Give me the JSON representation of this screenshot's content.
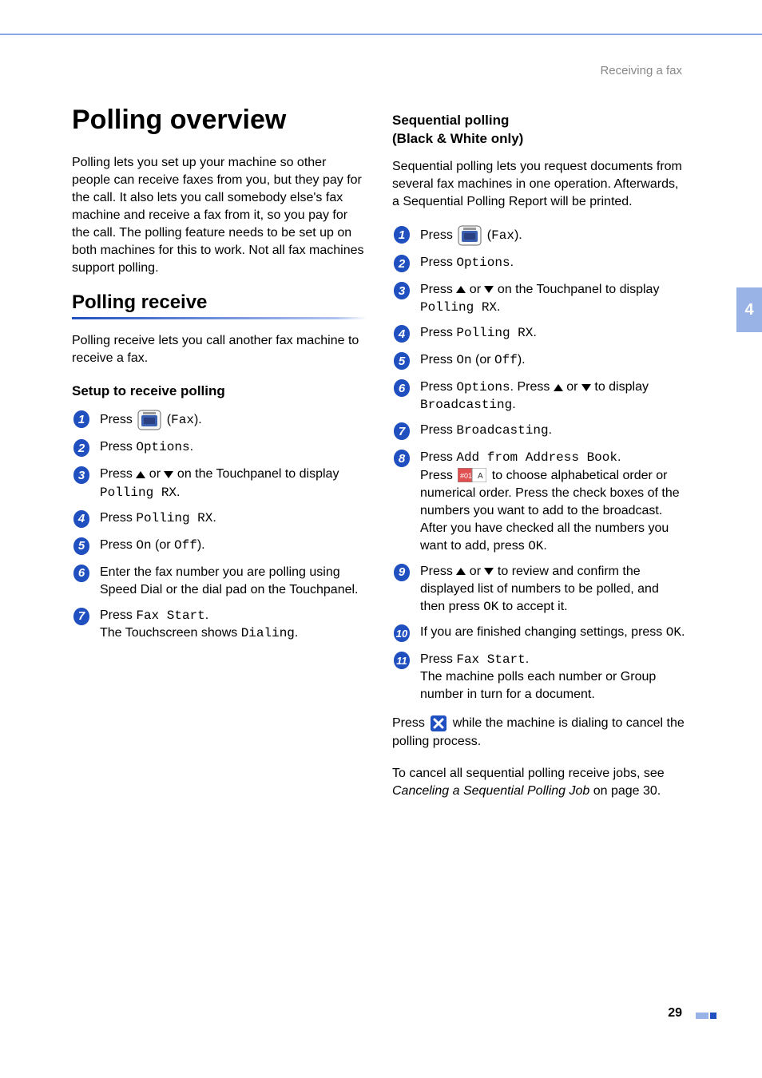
{
  "header": {
    "section": "Receiving a fax"
  },
  "sideTab": {
    "chapter": "4"
  },
  "left": {
    "h1": "Polling overview",
    "intro": "Polling lets you set up your machine so other people can receive faxes from you, but they pay for the call. It also lets you call somebody else's fax machine and receive a fax from it, so you pay for the call. The polling feature needs to be set up on both machines for this to work. Not all fax machines support polling.",
    "h2": "Polling receive",
    "subIntro": "Polling receive lets you call another fax machine to receive a fax.",
    "h3": "Setup to receive polling",
    "steps": {
      "s1a": "Press ",
      "s1b": " (",
      "s1c": "Fax",
      "s1d": ").",
      "s2a": "Press ",
      "s2b": "Options",
      "s2c": ".",
      "s3a": "Press ",
      "s3b": " or ",
      "s3c": " on the Touchpanel to display ",
      "s3d": "Polling RX",
      "s3e": ".",
      "s4a": "Press ",
      "s4b": "Polling RX",
      "s4c": ".",
      "s5a": "Press ",
      "s5b": "On",
      "s5c": " (or ",
      "s5d": "Off",
      "s5e": ").",
      "s6": "Enter the fax number you are polling using Speed Dial or the dial pad on the Touchpanel.",
      "s7a": "Press ",
      "s7b": "Fax Start",
      "s7c": ".",
      "s7line2a": "The Touchscreen shows ",
      "s7line2b": "Dialing",
      "s7line2c": "."
    }
  },
  "right": {
    "h3a": "Sequential polling",
    "h3b": "(Black & White only)",
    "intro": "Sequential polling lets you request documents from several fax machines in one operation. Afterwards, a Sequential Polling Report will be printed.",
    "steps": {
      "s1a": "Press ",
      "s1b": " (",
      "s1c": "Fax",
      "s1d": ").",
      "s2a": "Press ",
      "s2b": "Options",
      "s2c": ".",
      "s3a": "Press ",
      "s3b": " or ",
      "s3c": " on the Touchpanel to display ",
      "s3d": "Polling RX",
      "s3e": ".",
      "s4a": "Press ",
      "s4b": "Polling RX",
      "s4c": ".",
      "s5a": "Press ",
      "s5b": "On",
      "s5c": " (or ",
      "s5d": "Off",
      "s5e": ").",
      "s6a": "Press ",
      "s6b": "Options",
      "s6c": ". Press ",
      "s6d": " or ",
      "s6e": " to display ",
      "s6f": "Broadcasting",
      "s6g": ".",
      "s7a": "Press ",
      "s7b": "Broadcasting",
      "s7c": ".",
      "s8a": "Press ",
      "s8b": "Add from Address Book",
      "s8c": ".",
      "s8l2a": "Press ",
      "s8l2b": " to choose alphabetical order or numerical order. Press the check boxes of the numbers you want to add to the broadcast.",
      "s8l3a": "After you have checked all the numbers you want to add, press ",
      "s8l3b": "OK",
      "s8l3c": ".",
      "s9a": "Press ",
      "s9b": " or ",
      "s9c": " to review and confirm the displayed list of numbers to be polled, and then press ",
      "s9d": "OK",
      "s9e": " to accept it.",
      "s10a": "If you are finished changing settings, press ",
      "s10b": "OK",
      "s10c": ".",
      "s11a": "Press ",
      "s11b": "Fax Start",
      "s11c": ".",
      "s11l2": "The machine polls each number or Group number in turn for a document."
    },
    "tail1a": "Press ",
    "tail1b": " while the machine is dialing to cancel the polling process.",
    "tail2a": "To cancel all sequential polling receive jobs, see ",
    "tail2b": "Canceling a Sequential Polling Job",
    "tail2c": " on page 30."
  },
  "footer": {
    "pageNumber": "29"
  }
}
